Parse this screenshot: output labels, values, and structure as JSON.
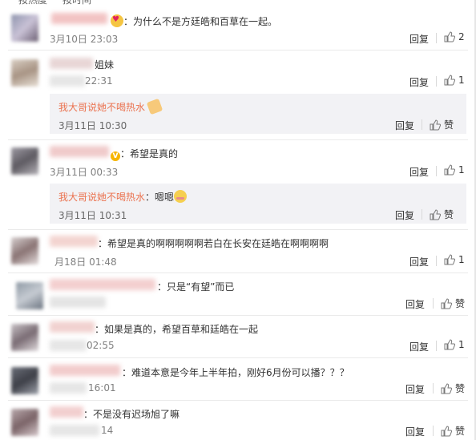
{
  "top_tabs": [
    "按热度",
    "按时间"
  ],
  "reply_label": "回复",
  "like_label": "赞",
  "comments": [
    {
      "content": "：为什么不是方廷皓和百草在一起。",
      "time": "3月10日 23:03",
      "likes": "2"
    },
    {
      "content": "姐妹",
      "time": "22:31",
      "likes": "1",
      "sub": {
        "name": "我大哥说她不喝热水",
        "content": "",
        "emoji": "handshake-emoji",
        "time": "3月11日 10:30"
      }
    },
    {
      "content": "：希望是真的",
      "time": "3月11日 00:33",
      "likes": "1",
      "sub": {
        "name": "我大哥说她不喝热水",
        "content": "：嗯嗯",
        "emoji": "shy-emoji",
        "time": "3月11日 10:31"
      }
    },
    {
      "content": "：希望是真的啊啊啊啊啊若白在长安在廷皓在啊啊啊啊",
      "time": "月18日 01:48",
      "likes": "1"
    },
    {
      "content": "：只是“有望”而已",
      "time": "",
      "likes": ""
    },
    {
      "content": "：如果是真的，希望百草和廷皓在一起",
      "time": "02:55",
      "likes": "1"
    },
    {
      "content": "：难道本意是今年上半年拍，刚好6月份可以播？？？",
      "time": "16:01",
      "likes": ""
    },
    {
      "content": "：不是没有迟场旭了嘛",
      "time": "14",
      "likes": ""
    }
  ],
  "colors": {
    "sub_name": "#eb7350",
    "sub_bg": "#f2f2f5",
    "time": "#808080"
  }
}
